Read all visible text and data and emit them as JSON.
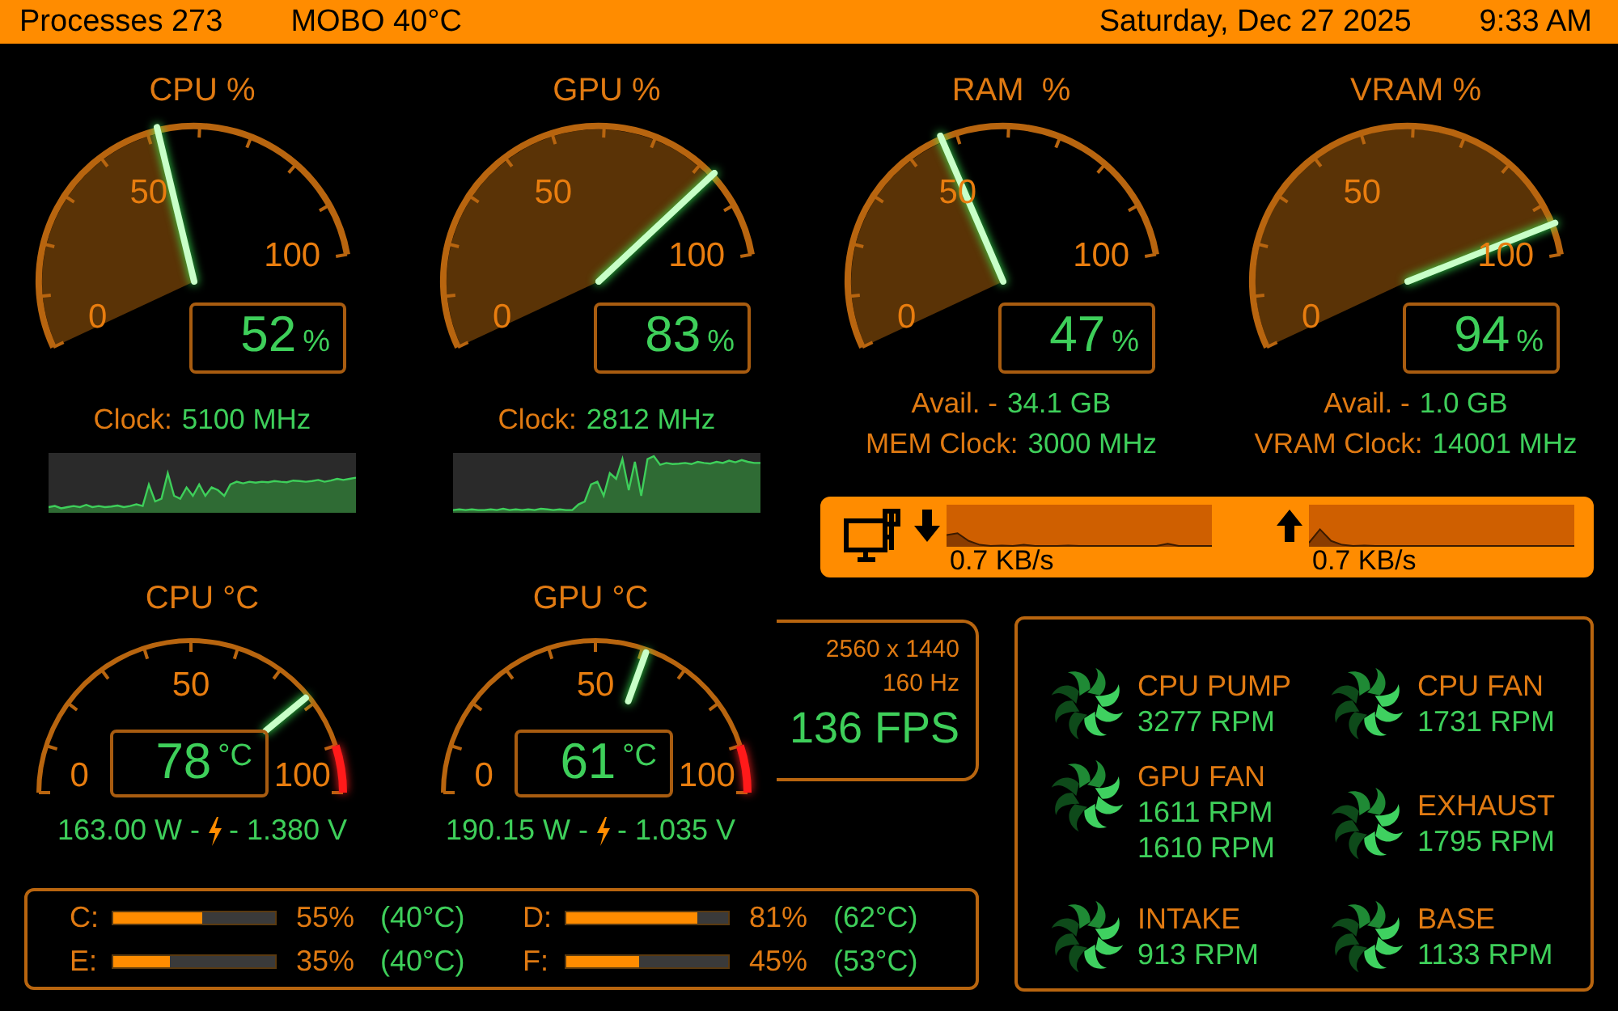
{
  "top_bar": {
    "processes": "Processes 273",
    "mobo": "MOBO 40°C",
    "date": "Saturday, Dec 27 2025",
    "time": "9:33 AM"
  },
  "load_gauges": [
    {
      "title": "CPU %",
      "ticks": [
        "0",
        "50",
        "100"
      ],
      "value": "52",
      "unit": "%",
      "level": 0.52,
      "kind": "sparkline",
      "info": [
        {
          "label": "Clock:",
          "value": "5100 MHz"
        }
      ]
    },
    {
      "title": "GPU %",
      "ticks": [
        "0",
        "50",
        "100"
      ],
      "value": "83",
      "unit": "%",
      "level": 0.83,
      "kind": "sparkline",
      "info": [
        {
          "label": "Clock:",
          "value": "2812 MHz"
        }
      ]
    },
    {
      "title": "RAM  %",
      "ticks": [
        "0",
        "50",
        "100"
      ],
      "value": "47",
      "unit": "%",
      "level": 0.47,
      "kind": "plain",
      "info": [
        {
          "label": "Avail. -",
          "value": "34.1 GB"
        },
        {
          "label": "MEM Clock:",
          "value": "3000 MHz"
        }
      ]
    },
    {
      "title": "VRAM %",
      "ticks": [
        "0",
        "50",
        "100"
      ],
      "value": "94",
      "unit": "%",
      "level": 0.94,
      "kind": "plain",
      "info": [
        {
          "label": "Avail. -",
          "value": "1.0 GB"
        },
        {
          "label": "VRAM Clock:",
          "value": "14001 MHz"
        }
      ]
    }
  ],
  "network": {
    "download": "0.7 KB/s",
    "upload": "0.7 KB/s"
  },
  "temp_gauges": [
    {
      "title": "CPU °C",
      "ticks": [
        "0",
        "50",
        "100"
      ],
      "value": "78",
      "unit": "°C",
      "level": 0.78,
      "power": "163.00 W -",
      "voltage": "- 1.380 V"
    },
    {
      "title": "GPU °C",
      "ticks": [
        "0",
        "50",
        "100"
      ],
      "value": "61",
      "unit": "°C",
      "level": 0.61,
      "power": "190.15 W -",
      "voltage": "- 1.035 V"
    }
  ],
  "display": {
    "resolution": "2560 x 1440",
    "refresh": "160 Hz",
    "fps": "136 FPS"
  },
  "drives": [
    {
      "label": "C:",
      "level": 0.55,
      "usage": "55%",
      "temp": "(40°C)"
    },
    {
      "label": "D:",
      "level": 0.81,
      "usage": "81%",
      "temp": "(62°C)"
    },
    {
      "label": "E:",
      "level": 0.35,
      "usage": "35%",
      "temp": "(40°C)"
    },
    {
      "label": "F:",
      "level": 0.45,
      "usage": "45%",
      "temp": "(53°C)"
    }
  ],
  "fans": [
    {
      "name": "CPU PUMP",
      "readings": [
        "3277 RPM"
      ]
    },
    {
      "name": "CPU FAN",
      "readings": [
        "1731 RPM"
      ]
    },
    {
      "name": "GPU FAN",
      "readings": [
        "1611 RPM",
        "1610 RPM"
      ]
    },
    {
      "name": "EXHAUST",
      "readings": [
        "1795 RPM"
      ]
    },
    {
      "name": "INTAKE",
      "readings": [
        "913 RPM"
      ]
    },
    {
      "name": "BASE",
      "readings": [
        "1133 RPM"
      ]
    }
  ]
}
